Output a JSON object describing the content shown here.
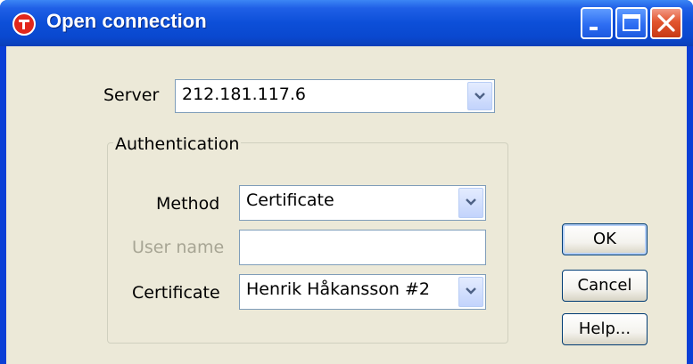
{
  "window": {
    "title": "Open connection",
    "controls": [
      "minimize-icon",
      "maximize-icon",
      "close-icon"
    ],
    "titlebar_color": "#0a48cf",
    "client_color": "#ece9d8"
  },
  "server": {
    "label": "Server",
    "value": "212.181.117.6"
  },
  "authentication": {
    "legend": "Authentication",
    "method_label": "Method",
    "method_value": "Certificate",
    "username_label": "User name",
    "username_value": "",
    "certificate_label": "Certificate",
    "certificate_value": "Henrik Håkansson #2"
  },
  "buttons": {
    "ok": "OK",
    "cancel": "Cancel",
    "help": "Help..."
  }
}
